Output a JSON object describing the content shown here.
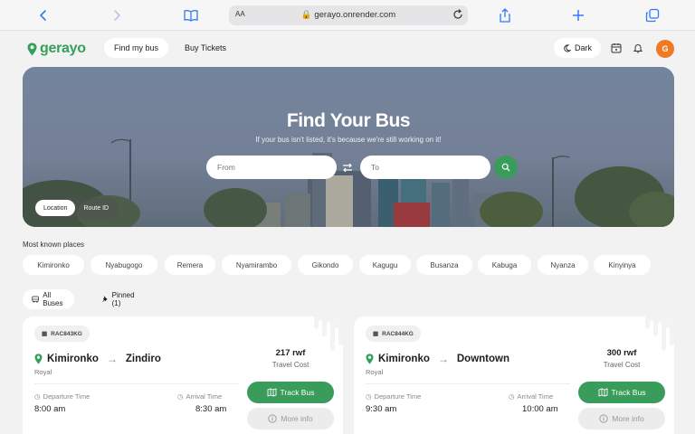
{
  "browser": {
    "text_size_label": "AA",
    "url": "gerayo.onrender.com"
  },
  "header": {
    "logo_text": "gerayo",
    "nav": [
      {
        "label": "Find my bus",
        "active": true
      },
      {
        "label": "Buy Tickets",
        "active": false
      }
    ],
    "theme_label": "Dark",
    "avatar_initial": "G"
  },
  "hero": {
    "title": "Find Your Bus",
    "subtitle": "If your bus isn't listed, it's because we're still working on it!",
    "from_placeholder": "From",
    "to_placeholder": "To",
    "mode_options": [
      {
        "label": "Location",
        "selected": true
      },
      {
        "label": "Route ID",
        "selected": false
      }
    ]
  },
  "places": {
    "heading": "Most known places",
    "items": [
      "Kimironko",
      "Nyabugogo",
      "Remera",
      "Nyamirambo",
      "Gikondo",
      "Kagugu",
      "Busanza",
      "Kabuga",
      "Nyanza",
      "Kinyinya"
    ]
  },
  "tabs": [
    {
      "label": "All Buses",
      "active": true
    },
    {
      "label": "Pinned (1)",
      "active": false
    }
  ],
  "buses": [
    {
      "plate": "RAC843KG",
      "from": "Kimironko",
      "to": "Zindiro",
      "operator": "Royal",
      "departure_label": "Departure Time",
      "departure": "8:00 am",
      "arrival_label": "Arrival Time",
      "arrival": "8:30 am",
      "price": "217 rwf",
      "price_label": "Travel Cost",
      "track_label": "Track Bus",
      "more_label": "More info"
    },
    {
      "plate": "RAC844KG",
      "from": "Kimironko",
      "to": "Downtown",
      "operator": "Royal",
      "departure_label": "Departure Time",
      "departure": "9:30 am",
      "arrival_label": "Arrival Time",
      "arrival": "10:00 am",
      "price": "300 rwf",
      "price_label": "Travel Cost",
      "track_label": "Track Bus",
      "more_label": "More info"
    }
  ],
  "colors": {
    "brand_green": "#35a05a",
    "button_green": "#3a9c5a",
    "avatar_orange": "#f07a24",
    "safari_blue": "#3478f6"
  }
}
